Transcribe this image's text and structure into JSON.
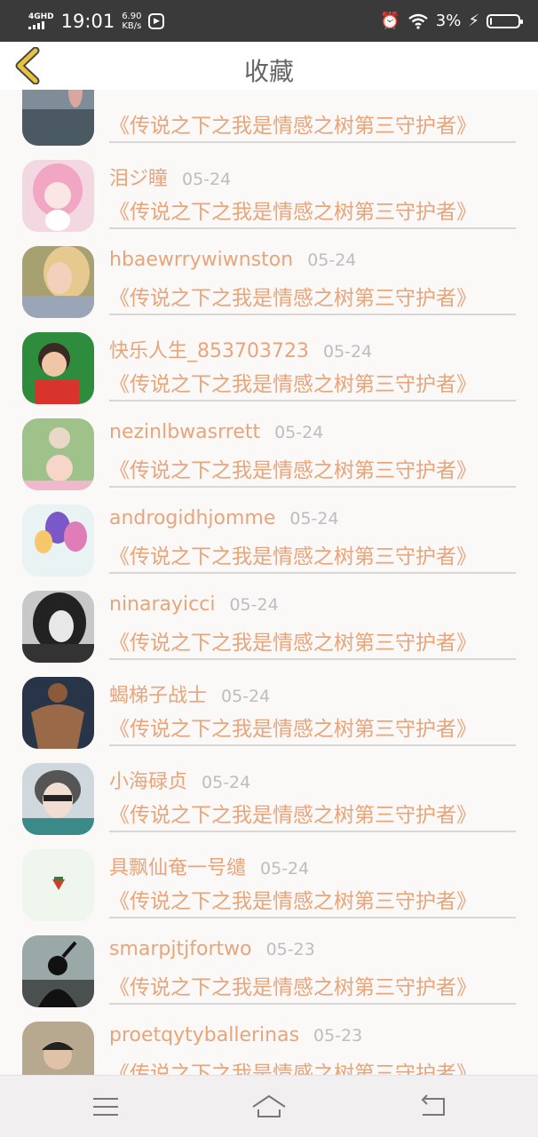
{
  "status_bar": {
    "network": "4GHD",
    "time": "19:01",
    "speed_value": "6.90",
    "speed_unit": "KB/s",
    "battery": "3%"
  },
  "header": {
    "title": "收藏",
    "back_icon": "chevron-left-icon"
  },
  "colors": {
    "accent": "#e8a57a",
    "date_gray": "#bdbdbd",
    "divider": "#d7d7d7",
    "background": "#fbf8f8",
    "back_arrow": "#e8c23b"
  },
  "favorites": [
    {
      "username": "",
      "date": "",
      "book": "《传说之下之我是情感之树第三守护者》",
      "avatar": "beach-photo"
    },
    {
      "username": "泪ジ瞳",
      "date": "05-24",
      "book": "《传说之下之我是情感之树第三守护者》",
      "avatar": "pink-anime-girl"
    },
    {
      "username": "hbaewrrywiwnston",
      "date": "05-24",
      "book": "《传说之下之我是情感之树第三守护者》",
      "avatar": "blonde-woman"
    },
    {
      "username": "快乐人生_853703723",
      "date": "05-24",
      "book": "《传说之下之我是情感之树第三守护者》",
      "avatar": "child-photo"
    },
    {
      "username": "nezinlbwasrrett",
      "date": "05-24",
      "book": "《传说之下之我是情感之树第三守护者》",
      "avatar": "couple-photo"
    },
    {
      "username": "androgidhjomme",
      "date": "05-24",
      "book": "《传说之下之我是情感之树第三守护者》",
      "avatar": "balloons"
    },
    {
      "username": "ninarayicci",
      "date": "05-24",
      "book": "《传说之下之我是情感之树第三守护者》",
      "avatar": "bw-girl"
    },
    {
      "username": "蝎梯子战士",
      "date": "05-24",
      "book": "《传说之下之我是情感之树第三守护者》",
      "avatar": "muscle-man"
    },
    {
      "username": "小海碌贞",
      "date": "05-24",
      "book": "《传说之下之我是情感之树第三守护者》",
      "avatar": "glasses-boy"
    },
    {
      "username": "具飘仙奄一号缱",
      "date": "05-24",
      "book": "《传说之下之我是情感之树第三守护者》",
      "avatar": "strawberry"
    },
    {
      "username": "smarpjtjfortwo",
      "date": "05-23",
      "book": "《传说之下之我是情感之树第三守护者》",
      "avatar": "silhouette"
    },
    {
      "username": "proetqytyballerinas",
      "date": "05-23",
      "book": "《传说之下之我是情感之树第三守护者》",
      "avatar": "man-cap"
    }
  ],
  "nav_bar": {
    "menu_icon": "menu-icon",
    "home_icon": "home-icon",
    "back_icon": "back-icon"
  }
}
